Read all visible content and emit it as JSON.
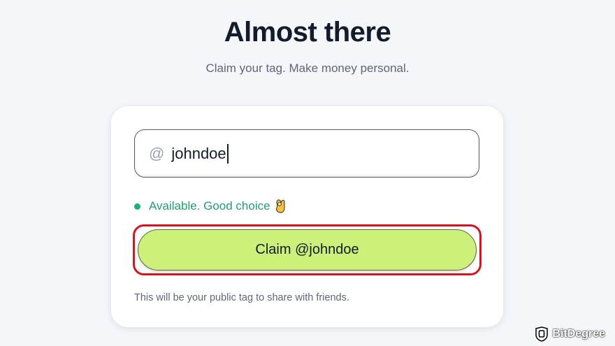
{
  "header": {
    "title": "Almost there",
    "subtitle": "Claim your tag. Make money personal."
  },
  "form": {
    "prefix": "@",
    "tag_value": "johndoe",
    "availability_text": "Available. Good choice",
    "availability_icon": "ok-hand-icon",
    "claim_button_label": "Claim @johndoe",
    "helper_text": "This will be your public tag to share with friends."
  },
  "colors": {
    "accent_button": "#cdf07a",
    "available_green": "#1f9f6e",
    "highlight_red": "#d6141c"
  },
  "watermark": {
    "brand": "BitDegree"
  }
}
